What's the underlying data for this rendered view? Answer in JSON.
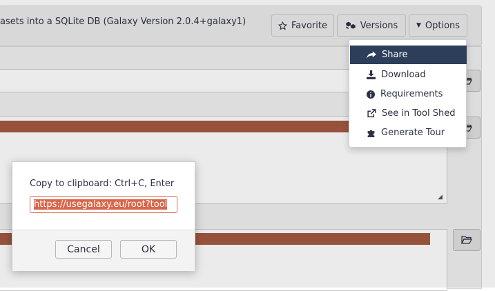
{
  "tool": {
    "title": "asets into a SQLite DB (Galaxy Version 2.0.4+galaxy1)",
    "buttons": {
      "favorite": "Favorite",
      "versions": "Versions",
      "options": "Options"
    }
  },
  "options_menu": {
    "items": [
      {
        "label": "Share",
        "icon": "share-icon"
      },
      {
        "label": "Download",
        "icon": "download-icon"
      },
      {
        "label": "Requirements",
        "icon": "info-icon"
      },
      {
        "label": "See in Tool Shed",
        "icon": "external-link-icon"
      },
      {
        "label": "Generate Tour",
        "icon": "puzzle-icon"
      }
    ],
    "active_item": "Share"
  },
  "clipboard_dialog": {
    "message": "Copy to clipboard: Ctrl+C, Enter",
    "url_value": "https://usegalaxy.eu/root?tool",
    "cancel_label": "Cancel",
    "ok_label": "OK"
  },
  "colors": {
    "accent_bar": "#a45a40",
    "menu_active": "#2c3e5a",
    "selection": "#d9654a"
  }
}
